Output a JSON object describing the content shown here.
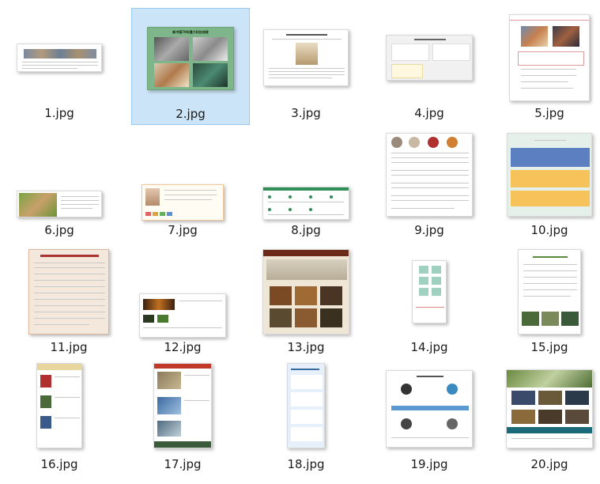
{
  "files": [
    {
      "name": "1.jpg"
    },
    {
      "name": "2.jpg",
      "thumb_title": "新中国70年重大科技成就"
    },
    {
      "name": "3.jpg"
    },
    {
      "name": "4.jpg"
    },
    {
      "name": "5.jpg"
    },
    {
      "name": "6.jpg"
    },
    {
      "name": "7.jpg"
    },
    {
      "name": "8.jpg"
    },
    {
      "name": "9.jpg"
    },
    {
      "name": "10.jpg"
    },
    {
      "name": "11.jpg"
    },
    {
      "name": "12.jpg"
    },
    {
      "name": "13.jpg"
    },
    {
      "name": "14.jpg"
    },
    {
      "name": "15.jpg"
    },
    {
      "name": "16.jpg"
    },
    {
      "name": "17.jpg"
    },
    {
      "name": "18.jpg"
    },
    {
      "name": "19.jpg"
    },
    {
      "name": "20.jpg"
    }
  ],
  "selected_index": 1,
  "colors": {
    "selection_bg": "#cce4f7",
    "selection_border": "#99c9ef"
  }
}
